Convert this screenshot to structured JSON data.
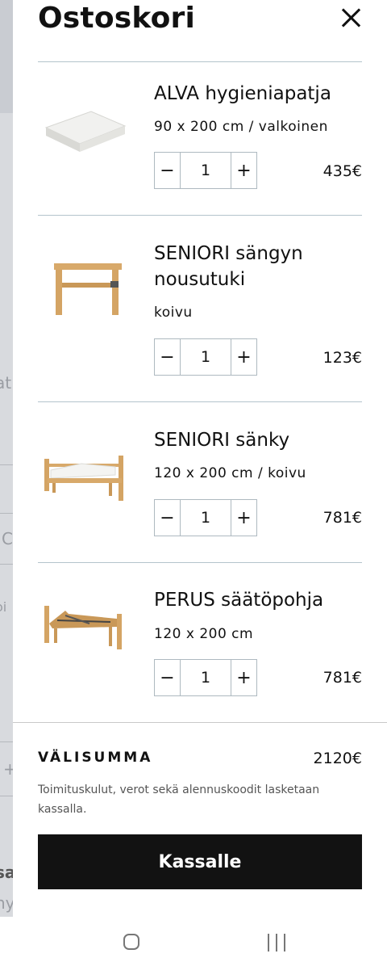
{
  "background": {
    "fragments": [
      "at",
      "C",
      "oi",
      "+",
      "sa",
      "ny"
    ]
  },
  "cart": {
    "title": "Ostoskori",
    "items": [
      {
        "name": "ALVA hygieniapatja",
        "variant": "90 x 200 cm / valkoinen",
        "quantity": "1",
        "price": "435€",
        "image": "mattress-image"
      },
      {
        "name": "SENIORI sängyn nousutuki",
        "variant": "koivu",
        "quantity": "1",
        "price": "123€",
        "image": "bed-support-image"
      },
      {
        "name": "SENIORI sänky",
        "variant": "120 x 200 cm / koivu",
        "quantity": "1",
        "price": "781€",
        "image": "bed-image"
      },
      {
        "name": "PERUS säätöpohja",
        "variant": "120 x 200 cm",
        "quantity": "1",
        "price": "781€",
        "image": "adjustable-bed-base-image"
      }
    ],
    "decrease_symbol": "−",
    "increase_symbol": "+",
    "subtotal_label": "VÄLISUMMA",
    "subtotal_value": "2120€",
    "note": "Toimituskulut, verot sekä alennuskoodit lasketaan kassalla.",
    "checkout_label": "Kassalle"
  },
  "icons": {
    "close": "close-icon",
    "home": "home-nav-icon",
    "recent": "recent-apps-icon"
  },
  "colors": {
    "checkout_button": "#121212",
    "divider": "#b4c4cc",
    "background_page": "#d8dade"
  }
}
